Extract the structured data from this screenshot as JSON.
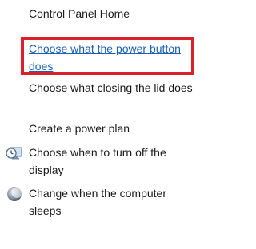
{
  "tasks": {
    "home": "Control Panel Home",
    "power_button": "Choose what the power button does",
    "closing_lid": "Choose what closing the lid does",
    "create_plan": "Create a power plan",
    "turn_off_display": "Choose when to turn off the display",
    "computer_sleeps": "Change when the computer sleeps"
  },
  "icons": {
    "display": "clock-monitor-icon",
    "sleep": "moon-sleep-icon"
  },
  "colors": {
    "link": "#1a5fb4",
    "highlight": "#d9202b",
    "text": "#1a1a1a"
  }
}
